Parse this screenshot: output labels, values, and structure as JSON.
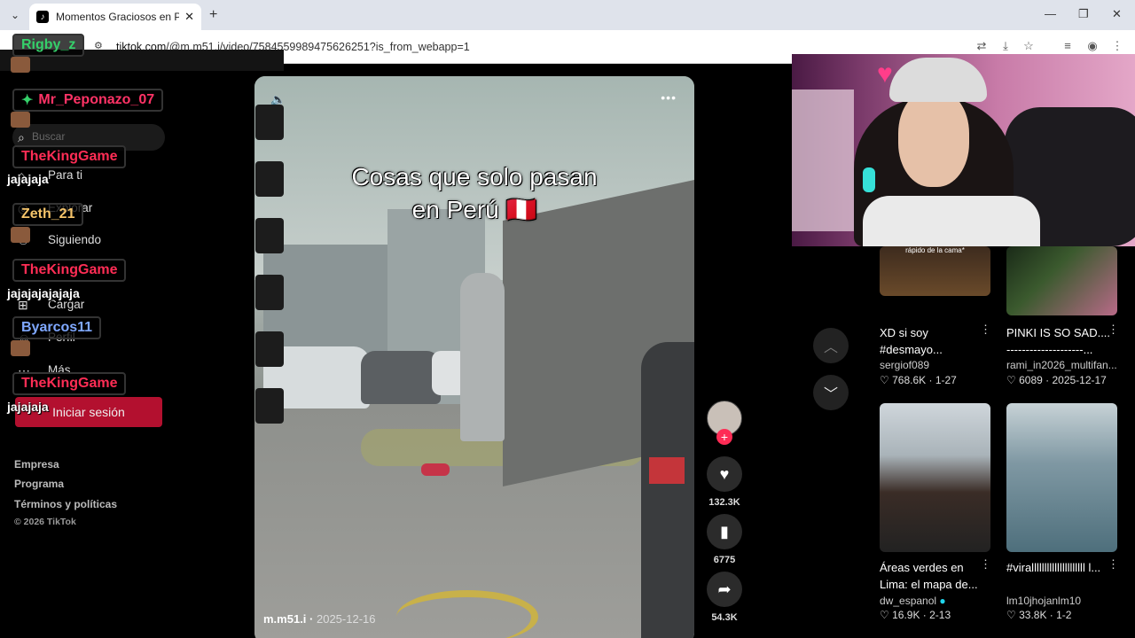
{
  "browser": {
    "tab_title": "Momentos Graciosos en Perú: D",
    "url_host": "tiktok.com",
    "url_path": "/@m.m51.i/video/7584559989475626251?is_from_webapp=1"
  },
  "sidebar": {
    "search_placeholder": "Buscar",
    "items": [
      "Para ti",
      "Explorar",
      "Siguiendo",
      "Cargar",
      "Perfil",
      "Más"
    ],
    "login_label": "Iniciar sesión",
    "footer_links": [
      "Empresa",
      "Programa",
      "Términos y políticas"
    ],
    "copyright": "© 2026 TikTok"
  },
  "video": {
    "caption_line1": "Cosas que solo pasan",
    "caption_line2": "en  Perú 🇵🇪",
    "author": "m.m51.i",
    "date": "2025-12-16",
    "likes": "132.3K",
    "saves": "6775",
    "shares": "54.3K"
  },
  "recommendations": [
    {
      "title": "XD si soy #desmayo...",
      "author": "sergiof089",
      "likes": "768.6K",
      "date": "1-27",
      "thumb_text": "rápido de la cama*"
    },
    {
      "title": "PINKI IS SO SAD.... --------------------...",
      "author": "rami_in2026_multifan...",
      "likes": "6089",
      "date": "2025-12-17"
    },
    {
      "title": "Áreas verdes en Lima: el mapa de...",
      "author": "dw_espanol",
      "likes": "16.9K",
      "date": "2-13"
    },
    {
      "title": "#viralllllllllllllllllllll l...",
      "author": "lm10jhojanlm10",
      "likes": "33.8K",
      "date": "1-2"
    }
  ],
  "chat": [
    {
      "user": "Rigby_z",
      "color": "#35d06a",
      "msg": ""
    },
    {
      "user": "Mr_Peponazo_07",
      "color": "#ff3366",
      "msg": ""
    },
    {
      "user": "TheKingGame",
      "color": "#ff2d55",
      "msg": "jajajaja"
    },
    {
      "user": "Zeth_21",
      "color": "#f5c46a",
      "msg": ""
    },
    {
      "user": "TheKingGame",
      "color": "#ff2d55",
      "msg": "jajajajajajaja"
    },
    {
      "user": "Byarcos11",
      "color": "#7fa8ff",
      "msg": ""
    },
    {
      "user": "TheKingGame",
      "color": "#ff2d55",
      "msg": "jajajaja"
    }
  ],
  "colors": {
    "tiktok_red": "#fe2c55",
    "login_red": "#b3102f"
  }
}
